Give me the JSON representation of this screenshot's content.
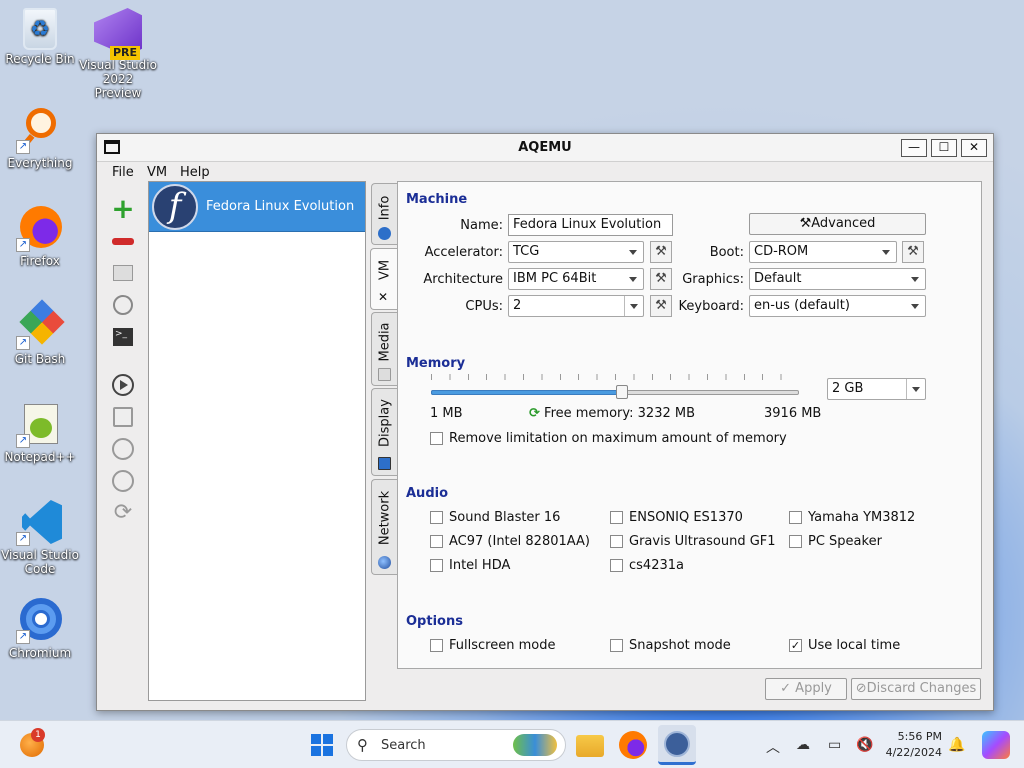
{
  "desktop": {
    "icons": [
      {
        "label": "Recycle Bin"
      },
      {
        "label": "Visual Studio 2022 Preview",
        "badge": "PRE"
      },
      {
        "label": "Everything"
      },
      {
        "label": "Firefox"
      },
      {
        "label": "Git Bash"
      },
      {
        "label": "Notepad++"
      },
      {
        "label": "Visual Studio Code"
      },
      {
        "label": "Chromium"
      }
    ]
  },
  "window": {
    "title": "AQEMU",
    "min": "—",
    "max": "☐",
    "close": "✕"
  },
  "menu": {
    "file": "File",
    "vm": "VM",
    "help": "Help"
  },
  "vm_list": [
    {
      "name": "Fedora Linux Evolution",
      "logo": "f"
    }
  ],
  "tabs": {
    "info": "Info",
    "vm": "VM",
    "media": "Media",
    "display": "Display",
    "network": "Network"
  },
  "machine": {
    "section": "Machine",
    "name_label": "Name:",
    "name_value": "Fedora Linux Evolution",
    "advanced": "Advanced",
    "accelerator_label": "Accelerator:",
    "accelerator_value": "TCG",
    "boot_label": "Boot:",
    "boot_value": "CD-ROM",
    "architecture_label": "Architecture",
    "architecture_value": "IBM PC 64Bit",
    "graphics_label": "Graphics:",
    "graphics_value": "Default",
    "cpus_label": "CPUs:",
    "cpus_value": "2",
    "keyboard_label": "Keyboard:",
    "keyboard_value": "en-us (default)"
  },
  "memory": {
    "section": "Memory",
    "value": "2 GB",
    "min": "1 MB",
    "free": "Free memory: 3232 MB",
    "max": "3916 MB",
    "slider_fraction": 0.52,
    "remove_limit": "Remove limitation on maximum amount of memory",
    "remove_limit_checked": false
  },
  "audio": {
    "section": "Audio",
    "devices": [
      {
        "label": "Sound Blaster 16",
        "checked": false
      },
      {
        "label": "ENSONIQ ES1370",
        "checked": false
      },
      {
        "label": "Yamaha YM3812",
        "checked": false
      },
      {
        "label": "AC97 (Intel 82801AA)",
        "checked": false
      },
      {
        "label": "Gravis Ultrasound GF1",
        "checked": false
      },
      {
        "label": "PC Speaker",
        "checked": false
      },
      {
        "label": "Intel HDA",
        "checked": false
      },
      {
        "label": "cs4231a",
        "checked": false
      }
    ]
  },
  "options": {
    "section": "Options",
    "items": [
      {
        "label": "Fullscreen mode",
        "checked": false
      },
      {
        "label": "Snapshot mode",
        "checked": false
      },
      {
        "label": "Use local time",
        "checked": true
      }
    ]
  },
  "buttons": {
    "apply": "Apply",
    "discard": "Discard Changes"
  },
  "taskbar": {
    "search": "Search",
    "time": "5:56 PM",
    "date": "4/22/2024",
    "notif_count": "1"
  },
  "colors": {
    "accent": "#3a8edb",
    "section": "#1b2e96"
  }
}
